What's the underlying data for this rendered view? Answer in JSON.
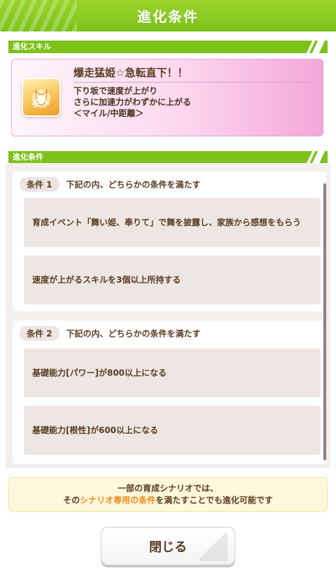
{
  "header": {
    "title": "進化条件"
  },
  "sections": {
    "skill_label": "進化スキル",
    "conditions_label": "進化条件"
  },
  "skill": {
    "name": "爆走猛姫☆急転直下！！",
    "desc_line1": "下り坂で速度が上がり",
    "desc_line2": "さらに加速力がわずかに上がる",
    "desc_line3": "＜マイル/中距離＞",
    "icon": "speed-skill-icon"
  },
  "conditions": [
    {
      "badge": "条件 1",
      "header": "下記の内、どちらかの条件を満たす",
      "items": [
        "育成イベント「舞い姫、奉りて」で舞を披露し、家族から感想をもらう",
        "速度が上がるスキルを3個以上所持する"
      ]
    },
    {
      "badge": "条件 2",
      "header": "下記の内、どちらかの条件を満たす",
      "items": [
        "基礎能力[パワー]が800以上になる",
        "基礎能力[根性]が600以上になる"
      ]
    }
  ],
  "notice": {
    "line1": "一部の育成シナリオでは、",
    "line2_prefix": "その",
    "line2_highlight": "シナリオ専用の条件",
    "line2_suffix": "を満たすことでも進化可能です"
  },
  "buttons": {
    "close_label": "閉じる"
  },
  "colors": {
    "accent": "#7cc21a",
    "highlight": "#ee8a1a",
    "skill_bg": "#f4a6da"
  }
}
